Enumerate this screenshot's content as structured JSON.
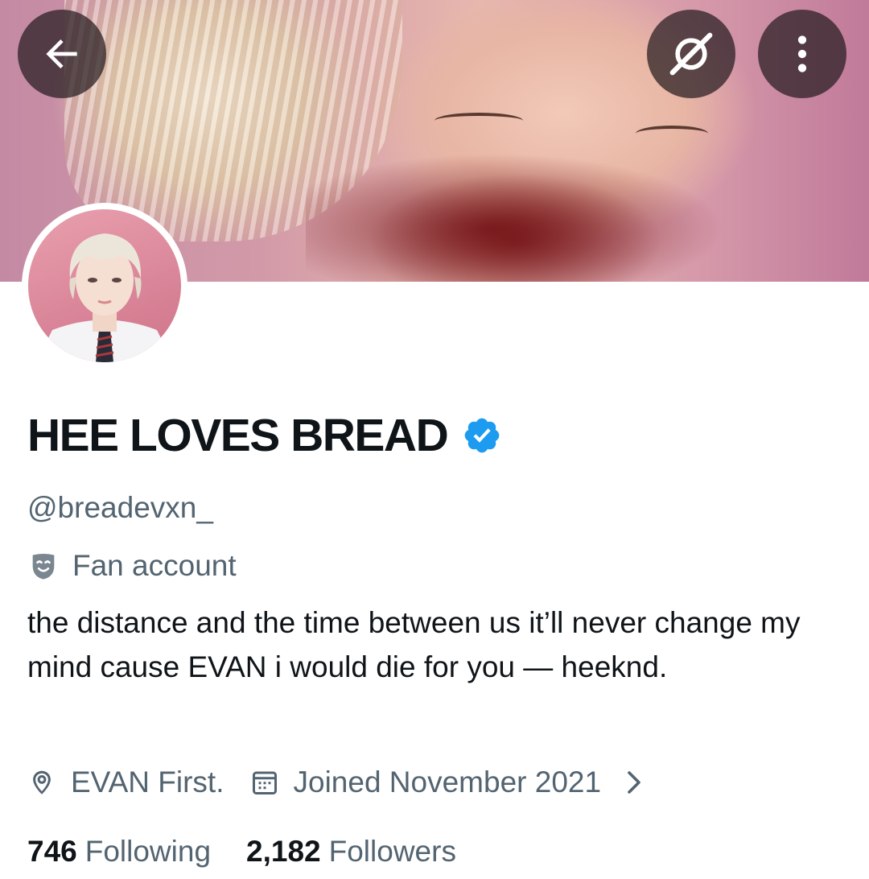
{
  "profile": {
    "display_name": "HEE LOVES BREAD",
    "handle": "@breadevxn_",
    "category": "Fan account",
    "bio": "the distance and the time between us it’ll never change my mind cause EVAN i would die for you — heeknd.",
    "location": "EVAN First.",
    "joined": "Joined November 2021",
    "following_count": "746",
    "following_label": "Following",
    "followers_count": "2,182",
    "followers_label": "Followers"
  },
  "icons": {
    "back": "arrow-left-icon",
    "grok": "grok-icon",
    "more": "more-vertical-icon",
    "verified": "verified-badge-icon",
    "category": "theater-mask-icon",
    "location": "location-pin-icon",
    "calendar": "calendar-icon",
    "chevron": "chevron-right-icon"
  },
  "colors": {
    "verified_blue": "#1d9bf0",
    "text_primary": "#0f1419",
    "text_secondary": "#536471"
  }
}
